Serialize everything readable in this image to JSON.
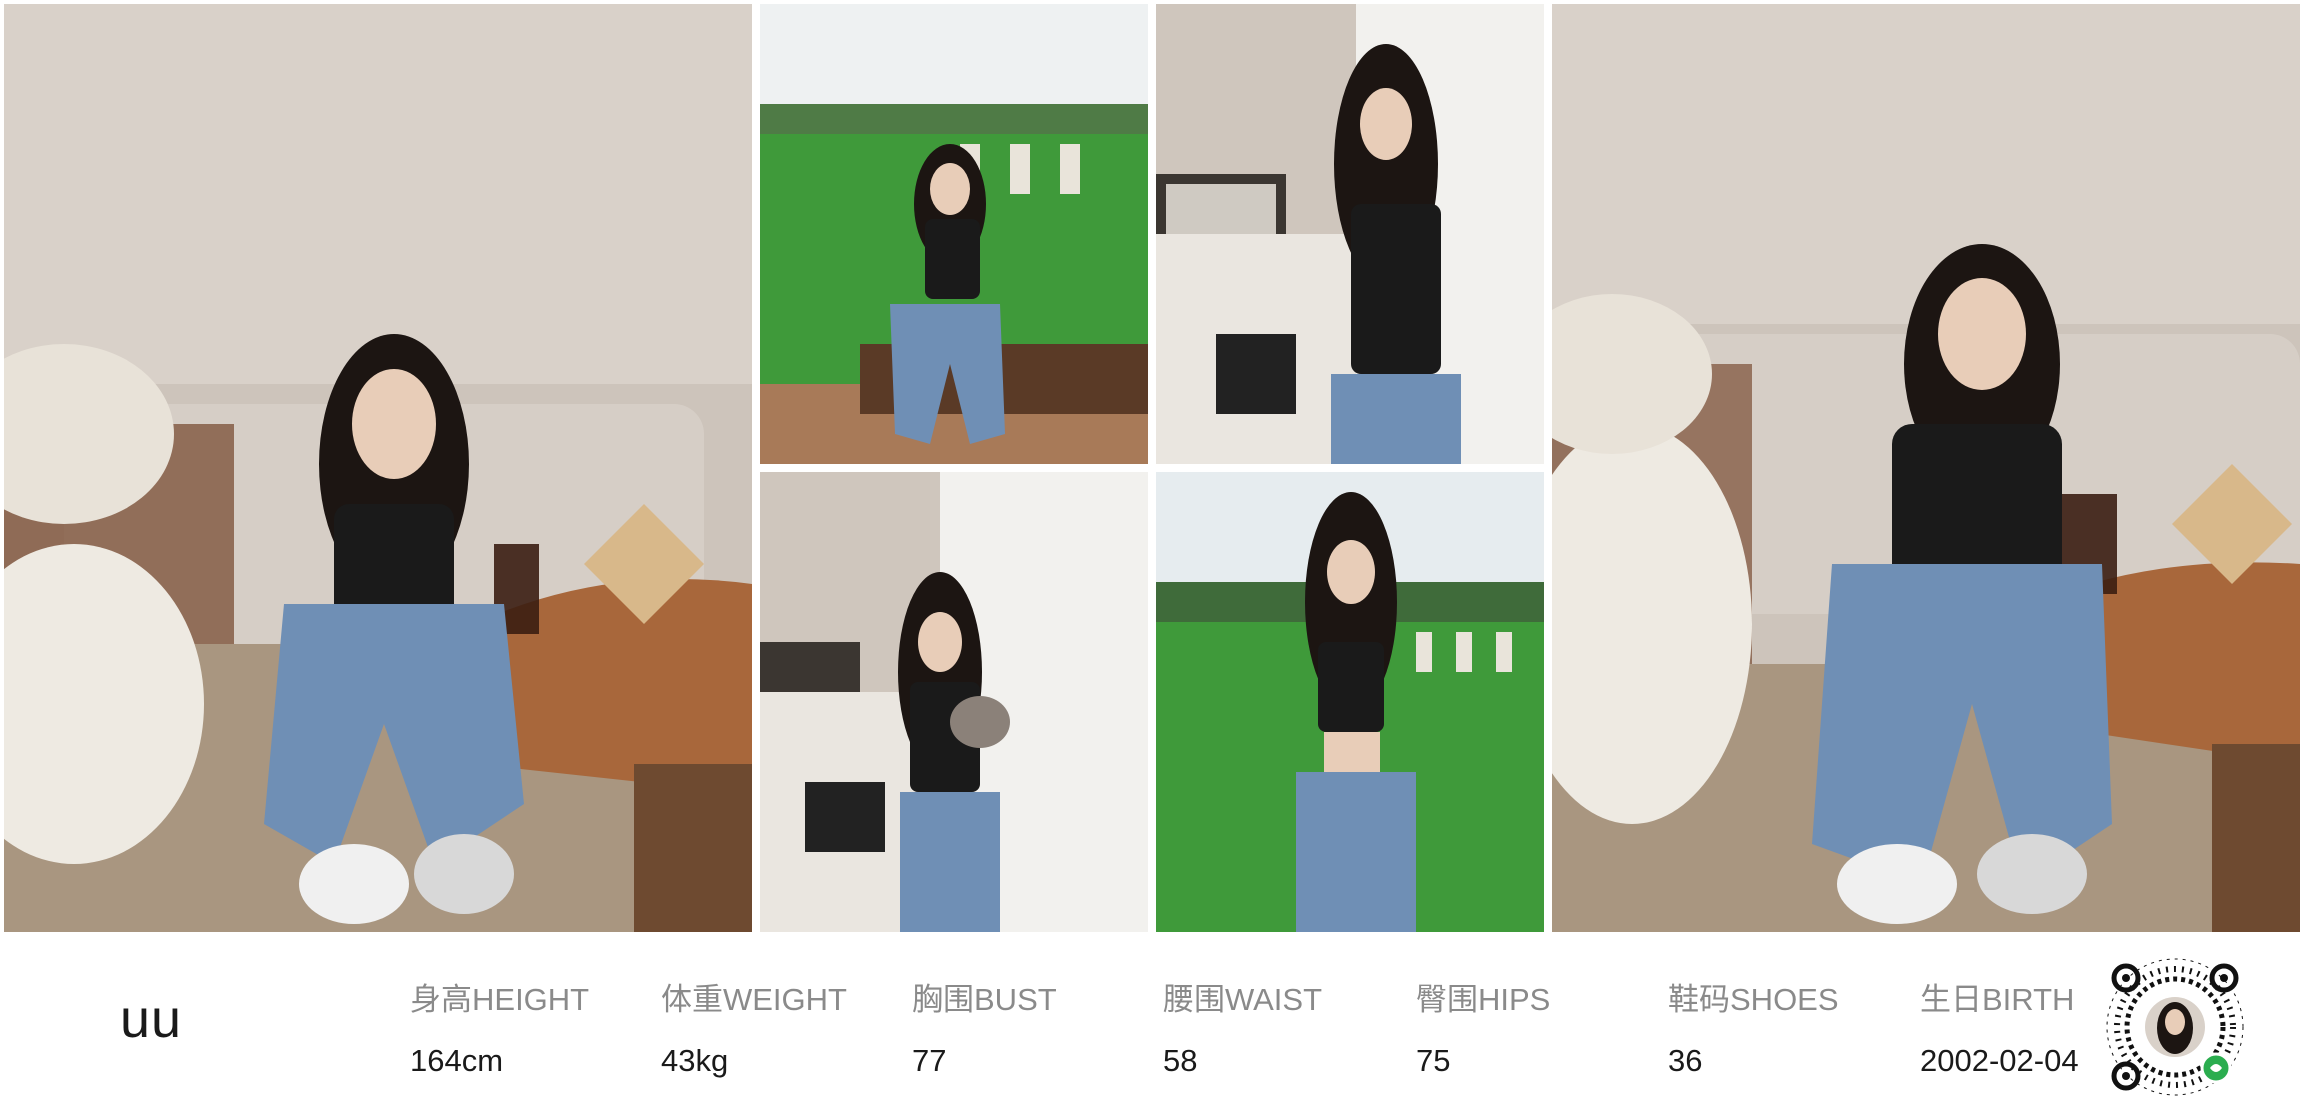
{
  "model": {
    "name": "uu"
  },
  "stats": [
    {
      "label": "身高HEIGHT",
      "value": "164cm"
    },
    {
      "label": "体重WEIGHT",
      "value": "43kg"
    },
    {
      "label": "胸围BUST",
      "value": "77"
    },
    {
      "label": "腰围WAIST",
      "value": "58"
    },
    {
      "label": "臀围HIPS",
      "value": "75"
    },
    {
      "label": "鞋码SHOES",
      "value": "36"
    },
    {
      "label": "生日BIRTH",
      "value": "2002-02-04"
    }
  ],
  "palette": {
    "wall": "#d9d1c9",
    "sofa": "#cfc7be",
    "table": "#a8673b",
    "denim": "#6f8fb5",
    "top": "#1a1a1a",
    "hair": "#1c1512",
    "skin": "#e8cdb8",
    "field": "#3f9a3a",
    "sky": "#e9eef0",
    "curtain": "#f2f1ee"
  }
}
